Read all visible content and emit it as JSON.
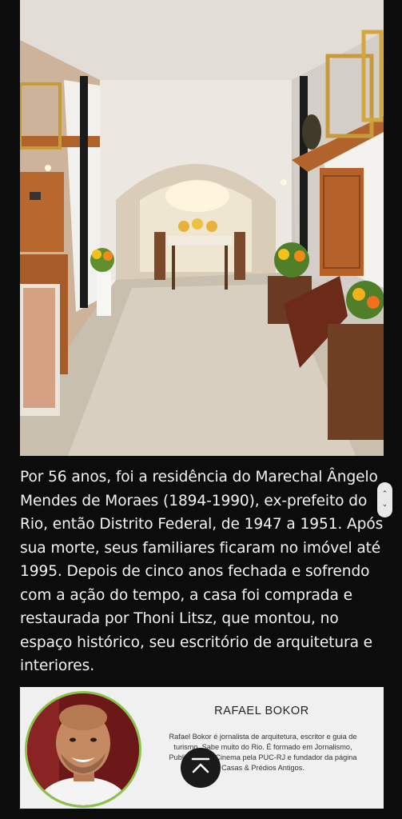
{
  "article": {
    "image_alt": "",
    "paragraph": "Por 56 anos, foi a residência do Marechal Ângelo Mendes de Moraes (1894-1990), ex-prefeito do Rio, então Distrito Federal, de 1947 a 1951. Após sua morte, seus familiares ficaram no imóvel até 1995. Depois de cinco anos fechada e sofrendo com a ação do tempo, a casa foi comprada e restaurada por Thoni Litsz, que montou, no espaço histórico, seu escritório de arquitetura e interiores."
  },
  "author": {
    "name": "RAFAEL BOKOR",
    "bio": "Rafael Bokor é jornalista de arquitetura, escritor e guia de turismo. Sabe muito do Rio. É formado em Jornalismo, Publicidade e Cinema pela PUC-RJ e fundador da página Casas & Prédios Antigos."
  },
  "controls": {
    "scroll_up_icon": "chevron-up-icon",
    "scroll_down_icon": "chevron-down-icon",
    "back_to_top_icon": "arrow-up-to-top-icon"
  },
  "colors": {
    "page_background": "#0c0c0c",
    "text": "#f2f2f2",
    "author_box": "#f0f0f0",
    "avatar_ring": "#8bc34a"
  }
}
